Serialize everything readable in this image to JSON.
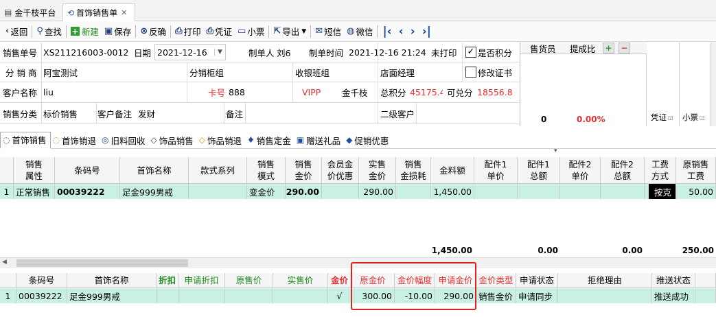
{
  "window_tabs": [
    {
      "label": "金千枝平台"
    },
    {
      "label": "首饰销售单"
    }
  ],
  "toolbar": {
    "back": "返回",
    "find": "查找",
    "new": "新建",
    "save": "保存",
    "reverse": "反确",
    "print": "打印",
    "voucher": "凭证",
    "receipt": "小票",
    "export": "导出",
    "sms": "短信",
    "wechat": "微信"
  },
  "form": {
    "order_no_label": "销售单号",
    "order_no": "XS211216003-0012",
    "date_label": "日期",
    "date": "2021-12-16",
    "creator_label": "制单人",
    "creator": "刘6",
    "created_time_label": "制单时间",
    "created_time": "2021-12-16 21:24",
    "print_status": "未打印",
    "points_label": "是否积分",
    "branch_label": "分 销 商",
    "branch": "阿宝测试",
    "counter_label": "分销柜组",
    "cashier_group_label": "收银班组",
    "manager_label": "店面经理",
    "modify_cert_label": "修改证书",
    "customer_label": "客户名称",
    "customer": "liu",
    "card_label": "卡号",
    "card": "888",
    "level": "VIPP",
    "brand": "金千枝",
    "total_points_label": "总积分",
    "total_points": "45175.4",
    "redeem_label": "可兑分",
    "redeem": "18556.8",
    "category_label": "销售分类",
    "category": "标价销售",
    "cust_note_label": "客户备注",
    "cust_note": "发财",
    "note_label": "备注",
    "level2_label": "二级客户"
  },
  "sales_panel": {
    "seller_header": "售货员",
    "commission_header": "提成比",
    "count": "0",
    "pct": "0.00%",
    "voucher_label": "凭证",
    "receipt_label": "小票"
  },
  "section_tabs": [
    "首饰销售",
    "首饰销退",
    "旧料回收",
    "饰品销售",
    "饰品销退",
    "销售定金",
    "赠送礼品",
    "促销优惠"
  ],
  "main_grid": {
    "headers": [
      "",
      "销售\n属性",
      "条码号",
      "首饰名称",
      "款式系列",
      "销售\n模式",
      "销售\n金价",
      "会员金\n价优惠",
      "实售\n金价",
      "销售\n金损耗",
      "金料额",
      "配件1\n单价",
      "配件1\n总额",
      "配件2\n单价",
      "配件2\n总额",
      "工费\n方式",
      "原销售\n工费"
    ],
    "row": [
      "1",
      "正常销售",
      "00039222",
      "足金999男戒",
      "",
      "变金价",
      "290.00",
      "",
      "290.00",
      "",
      "1,450.00",
      "",
      "",
      "",
      "",
      "按克",
      "50.00"
    ],
    "footer": {
      "gold_amount": "1,450.00",
      "acc1_total": "0.00",
      "acc2_total": "0.00",
      "labor": "250.00"
    }
  },
  "sub_grid": {
    "headers": [
      "",
      "条码号",
      "首饰名称",
      "折扣",
      "申请折扣",
      "原售价",
      "实售价",
      "金价",
      "原金价",
      "金价幅度",
      "申请金价",
      "金价类型",
      "申请状态",
      "拒绝理由",
      "推送状态"
    ],
    "row": [
      "1",
      "00039222",
      "足金999男戒",
      "",
      "",
      "",
      "",
      "√",
      "300.00",
      "-10.00",
      "290.00",
      "销售金价",
      "申请同步",
      "",
      "推送成功"
    ]
  }
}
